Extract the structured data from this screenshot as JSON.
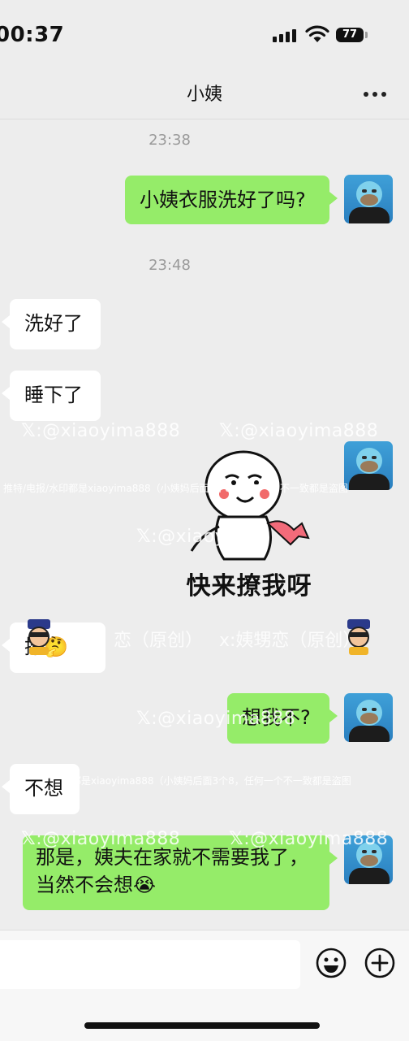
{
  "status_bar": {
    "time": "00:37",
    "battery": "77"
  },
  "header": {
    "title": "小姨"
  },
  "chat": {
    "timestamps": [
      "23:38",
      "23:48"
    ],
    "messages": [
      {
        "side": "right",
        "text": "小姨衣服洗好了吗?"
      },
      {
        "side": "left",
        "text": "洗好了"
      },
      {
        "side": "left",
        "text": "睡下了"
      },
      {
        "side": "right",
        "sticker_text": "快来撩我呀"
      },
      {
        "side": "left",
        "text": "撩🤔"
      },
      {
        "side": "right",
        "text": "想我不?"
      },
      {
        "side": "left",
        "text": "不想"
      },
      {
        "side": "right",
        "text": "那是，姨夫在家就不需要我了，当然不会想😭"
      }
    ]
  },
  "watermarks": {
    "handle": ":@xiaoyima888",
    "handle_partial": ":@xiaoyi",
    "line_a": "推特/电报/水印都是xiaoyima888（小姨妈后面3个8，任何一个不一致都是盗图",
    "line_b": "都是xiaoyima888（小姨妈后面3个8，任何一个不一致都是盗图",
    "tag_a": "恋（原创）",
    "tag_b": "x:姨甥恋（原创）"
  },
  "input": {
    "placeholder": ""
  },
  "icons": {
    "more": "more-dots-icon",
    "emoji": "emoji-icon",
    "plus": "plus-icon"
  },
  "colors": {
    "bubble_self": "#95ec69",
    "bubble_other": "#ffffff",
    "background": "#ededed"
  }
}
